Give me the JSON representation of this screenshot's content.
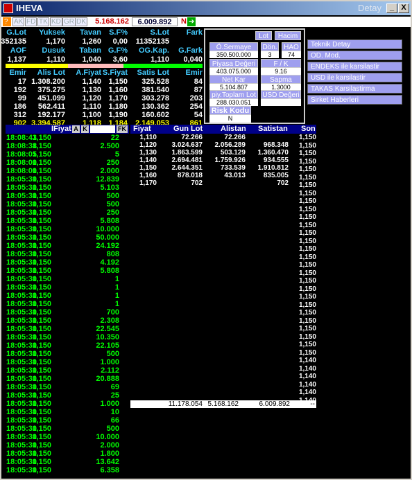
{
  "window": {
    "title": "IHEVA",
    "title_right": "Detay",
    "btn_min": "_",
    "btn_max": "□",
    "btn_close": "X"
  },
  "toolbar": {
    "tabs": [
      "AK",
      "FD",
      "TK",
      "KD",
      "GR",
      "DK"
    ],
    "val1": "5.168.162",
    "val2": "6.009.892",
    "n": "N"
  },
  "summary": {
    "hdr1": [
      "G.Lot",
      "Yuksek",
      "Tavan",
      "S.F%",
      "S.Lot",
      "Fark"
    ],
    "val1": [
      "11352135",
      "1,170",
      "1,260",
      "0,00",
      "11352135",
      ""
    ],
    "hdr2": [
      "AOF",
      "Dusuk",
      "Taban",
      "G.F%",
      "OG.Kap.",
      "G.Fark"
    ],
    "val2": [
      "1,137",
      "1,110",
      "1,040",
      "3,60",
      "1,110",
      "0,040"
    ],
    "hdr3": [
      "Emir",
      "Alis Lot",
      "A.Fiyat",
      "S.Fiyat",
      "Satis Lot",
      "Emir"
    ],
    "book": [
      [
        "17",
        "1.308.200",
        "1,140",
        "1,150",
        "325.528",
        "84"
      ],
      [
        "192",
        "375.275",
        "1,130",
        "1,160",
        "381.540",
        "87"
      ],
      [
        "99",
        "451.099",
        "1,120",
        "1,170",
        "303.278",
        "203"
      ],
      [
        "186",
        "562.411",
        "1,110",
        "1,180",
        "130.362",
        "254"
      ],
      [
        "312",
        "192.177",
        "1,100",
        "1,190",
        "160.602",
        "54"
      ]
    ],
    "totals": [
      "902",
      "3.394.587",
      "1,118",
      "1,184",
      "2.149.053",
      "861"
    ]
  },
  "mid": {
    "lot": "Lot",
    "hacim": "Hacim",
    "osermaye": "Ö.Sermaye",
    "osermaye_v": "350.500.000",
    "don": "Dön.",
    "don_v": "3",
    "hao": "HAO",
    "hao_v": "74",
    "piyasa": "Piyasa Değeri",
    "piyasa_v": "403.075.000",
    "fk": "F / K",
    "fk_v": "9.16",
    "netkar": "Net Kar",
    "netkar_v": "5.104.807",
    "sapma": "Sapma",
    "sapma_v": "1.3000",
    "piytop": "piy.Toplam Lot",
    "piytop_v": "288.030.051",
    "usd": "USD Değeri",
    "usd_v": "",
    "risk": "Risk Kodu",
    "risk_v": "N"
  },
  "links": [
    "Teknik Detay",
    "OD. Mod.",
    "ENDEKS ile karsilastir",
    "USD ile karsilastir",
    "TAKAS Karsilastirma",
    "Sirket Haberleri"
  ],
  "trades_header": {
    "fiyat": "IFiyat",
    "a": "A",
    "k": "K",
    "fk": "FK"
  },
  "trades": [
    [
      "18:08:43",
      "1,150",
      "22"
    ],
    [
      "18:08:38",
      "1,150",
      "2.500"
    ],
    [
      "18:08:05",
      "1,150",
      "5"
    ],
    [
      "18:08:00",
      "1,150",
      "250"
    ],
    [
      "18:08:00",
      "1,150",
      "2.000"
    ],
    [
      "18:05:30",
      "1,150",
      "12.839"
    ],
    [
      "18:05:30",
      "1,150",
      "5.103"
    ],
    [
      "18:05:30",
      "1,150",
      "500"
    ],
    [
      "18:05:30",
      "1,150",
      "500"
    ],
    [
      "18:05:30",
      "1,150",
      "250"
    ],
    [
      "18:05:30",
      "1,150",
      "5.808"
    ],
    [
      "18:05:30",
      "1,150",
      "10.000"
    ],
    [
      "18:05:30",
      "1,150",
      "50.000"
    ],
    [
      "18:05:30",
      "1,150",
      "24.192"
    ],
    [
      "18:05:30",
      "1,150",
      "808"
    ],
    [
      "18:05:30",
      "1,150",
      "4.192"
    ],
    [
      "18:05:30",
      "1,150",
      "5.808"
    ],
    [
      "18:05:30",
      "1,150",
      "1"
    ],
    [
      "18:05:30",
      "1,150",
      "1"
    ],
    [
      "18:05:30",
      "1,150",
      "1"
    ],
    [
      "18:05:30",
      "1,150",
      "1"
    ],
    [
      "18:05:30",
      "1,150",
      "700"
    ],
    [
      "18:05:30",
      "1,150",
      "2.308"
    ],
    [
      "18:05:30",
      "1,150",
      "22.545"
    ],
    [
      "18:05:30",
      "1,150",
      "10.350"
    ],
    [
      "18:05:30",
      "1,150",
      "22.105"
    ],
    [
      "18:05:30",
      "1,150",
      "500"
    ],
    [
      "18:05:30",
      "1,150",
      "1.000"
    ],
    [
      "18:05:30",
      "1,150",
      "2.112"
    ],
    [
      "18:05:30",
      "1,150",
      "20.888"
    ],
    [
      "18:05:30",
      "1,150",
      "69"
    ],
    [
      "18:05:30",
      "1,150",
      "25"
    ],
    [
      "18:05:30",
      "1,150",
      "1.000"
    ],
    [
      "18:05:30",
      "1,150",
      "10"
    ],
    [
      "18:05:30",
      "1,150",
      "66"
    ],
    [
      "18:05:30",
      "1,150",
      "500"
    ],
    [
      "18:05:30",
      "1,150",
      "10.000"
    ],
    [
      "18:05:30",
      "1,150",
      "2.000"
    ],
    [
      "18:05:30",
      "1,150",
      "1.800"
    ],
    [
      "18:05:30",
      "1,150",
      "13.642"
    ],
    [
      "18:05:30",
      "1,150",
      "6.358"
    ]
  ],
  "depth_header": {
    "fiyat": "Fiyat",
    "gunlot": "Gun Lot",
    "alistan": "Alistan",
    "satistan": "Satistan",
    "son": "Son"
  },
  "depth": [
    [
      "1,110",
      "72.266",
      "72.266",
      ""
    ],
    [
      "1,120",
      "3.024.637",
      "2.056.289",
      "968.348"
    ],
    [
      "1,130",
      "1.863.599",
      "503.129",
      "1.360.470"
    ],
    [
      "1,140",
      "2.694.481",
      "1.759.926",
      "934.555"
    ],
    [
      "1,150",
      "2.644.351",
      "733.539",
      "1.910.812"
    ],
    [
      "1,160",
      "878.018",
      "43.013",
      "835.005"
    ],
    [
      "1,170",
      "702",
      "",
      "702"
    ]
  ],
  "son_values": [
    "1,150",
    "1,150",
    "1,150",
    "1,150",
    "1,150",
    "1,150",
    "1,150",
    "1,150",
    "1,150",
    "1,150",
    "1,150",
    "1,150",
    "1,150",
    "1,150",
    "1,150",
    "1,150",
    "1,150",
    "1,150",
    "1,150",
    "1,150",
    "1,150",
    "1,150",
    "1,150",
    "1,150",
    "1,150",
    "1,150",
    "1,150",
    "1,150",
    "1,140",
    "1,140",
    "1,140",
    "1,140",
    "1,140",
    "1,140"
  ],
  "totals": {
    "gunlot": "11.178.054",
    "alistan": "5.168.162",
    "satistan": "6.009.892",
    "son": "--"
  }
}
